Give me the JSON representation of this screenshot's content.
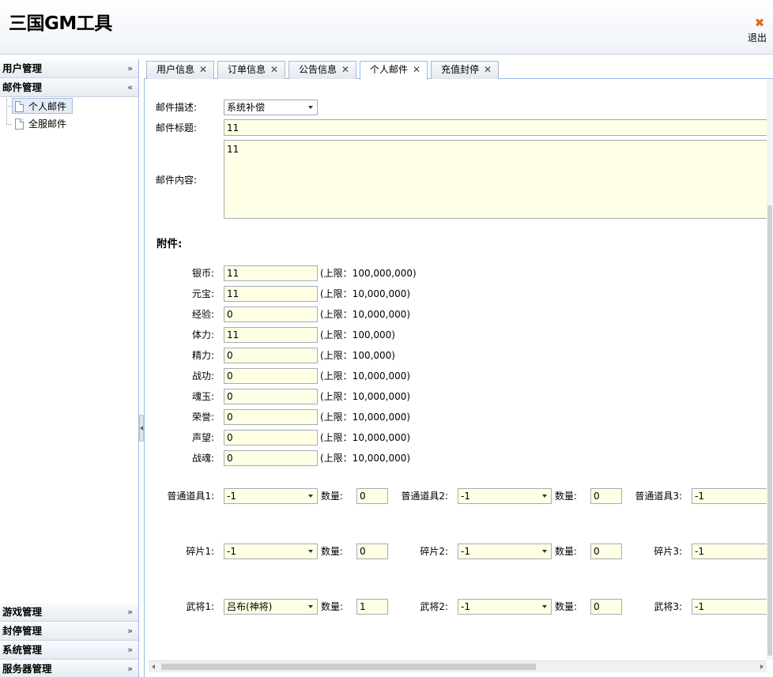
{
  "app_title": "三国GM工具",
  "logout_label": "退出",
  "west": {
    "panels": [
      {
        "label": "用户管理",
        "chevron": "»"
      },
      {
        "label": "邮件管理",
        "chevron": "«"
      }
    ],
    "tree_items": [
      {
        "label": "个人邮件"
      },
      {
        "label": "全服邮件"
      }
    ],
    "bottom_panels": [
      {
        "label": "游戏管理"
      },
      {
        "label": "封停管理"
      },
      {
        "label": "系统管理"
      },
      {
        "label": "服务器管理"
      }
    ]
  },
  "tabs": [
    {
      "label": "用户信息"
    },
    {
      "label": "订单信息"
    },
    {
      "label": "公告信息"
    },
    {
      "label": "个人邮件"
    },
    {
      "label": "充值封停"
    }
  ],
  "tab_close": "✕",
  "form": {
    "desc_label": "邮件描述:",
    "desc_value": "系统补偿",
    "title_label": "邮件标题:",
    "title_value": "11",
    "content_label": "邮件内容:",
    "content_value": "11",
    "attach_title": "附件:"
  },
  "resources": [
    {
      "label": "银币:",
      "value": "11",
      "limit": "(上限：100,000,000)"
    },
    {
      "label": "元宝:",
      "value": "11",
      "limit": "(上限：10,000,000)"
    },
    {
      "label": "经验:",
      "value": "0",
      "limit": "(上限：10,000,000)"
    },
    {
      "label": "体力:",
      "value": "11",
      "limit": "(上限：100,000)"
    },
    {
      "label": "精力:",
      "value": "0",
      "limit": "(上限：100,000)"
    },
    {
      "label": "战功:",
      "value": "0",
      "limit": "(上限：10,000,000)"
    },
    {
      "label": "魂玉:",
      "value": "0",
      "limit": "(上限：10,000,000)"
    },
    {
      "label": "荣誉:",
      "value": "0",
      "limit": "(上限：10,000,000)"
    },
    {
      "label": "声望:",
      "value": "0",
      "limit": "(上限：10,000,000)"
    },
    {
      "label": "战魂:",
      "value": "0",
      "limit": "(上限：10,000,000)"
    }
  ],
  "qty_label": "数量:",
  "item_rows": [
    {
      "items": [
        {
          "label": "普通道具1:",
          "value": "-1",
          "qty": "0"
        },
        {
          "label": "普通道具2:",
          "value": "-1",
          "qty": "0"
        },
        {
          "label": "普通道具3:",
          "value": "-1"
        }
      ]
    },
    {
      "items": [
        {
          "label": "碎片1:",
          "value": "-1",
          "qty": "0"
        },
        {
          "label": "碎片2:",
          "value": "-1",
          "qty": "0"
        },
        {
          "label": "碎片3:",
          "value": "-1"
        }
      ]
    },
    {
      "items": [
        {
          "label": "武将1:",
          "value": "吕布(神将)",
          "qty": "1"
        },
        {
          "label": "武将2:",
          "value": "-1",
          "qty": "0"
        },
        {
          "label": "武将3:",
          "value": "-1"
        }
      ]
    }
  ]
}
